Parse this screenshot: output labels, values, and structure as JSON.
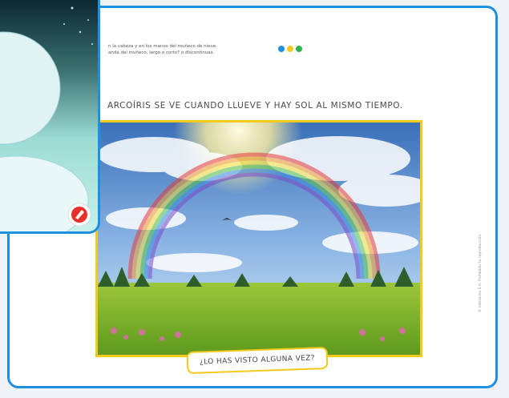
{
  "page": {
    "instructions": "n la cabeza y en los manos del muñeco de nieve. anda del muñeco, largo o corto? o discontinuas.",
    "statement": "ARCOÍRIS SE VE CUANDO LLUEVE Y HAY SOL AL MISMO TIEMPO.",
    "question": "¿LO HAS VISTO ALGUNA VEZ?",
    "copyright": "© ediciones S.A. Prohibida su reproducción"
  },
  "dots": [
    "#1f8fe0",
    "#f3c91c",
    "#2db34a"
  ],
  "icons": {
    "badge": "pencil-icon"
  },
  "colors": {
    "frame": "#1f8fe0",
    "highlight": "#f3c91c"
  }
}
